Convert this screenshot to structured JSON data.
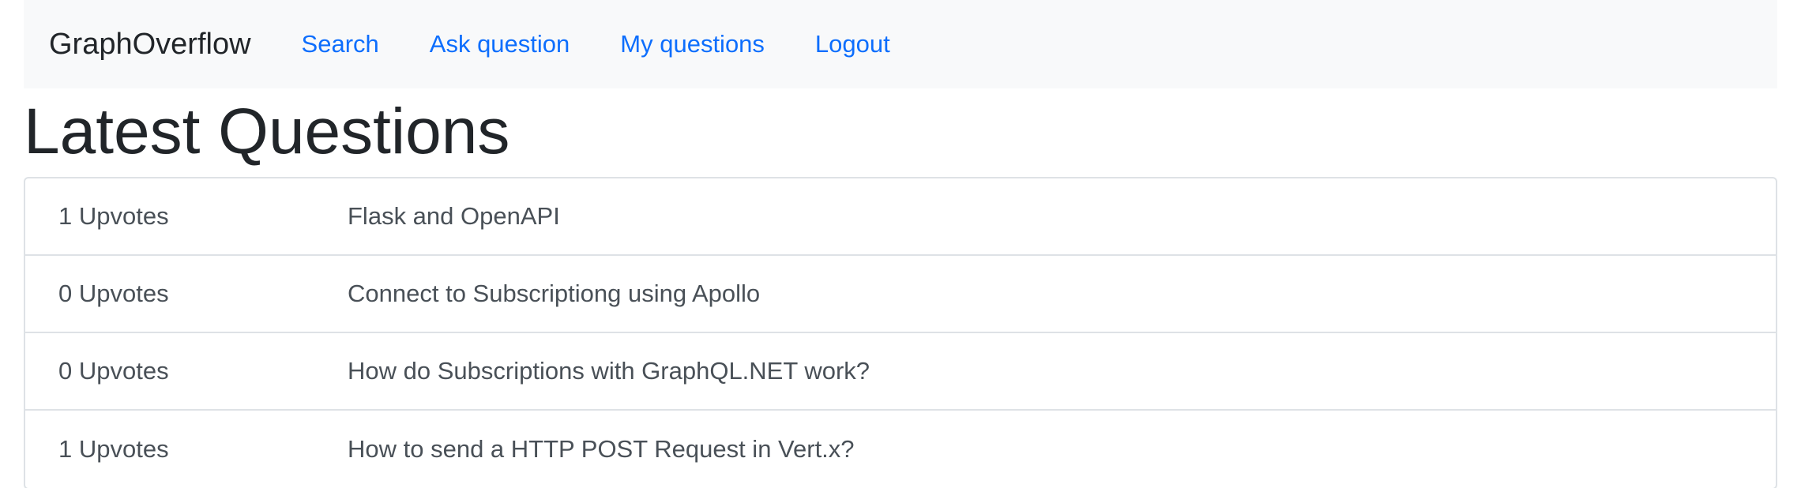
{
  "navbar": {
    "brand": "GraphOverflow",
    "links": [
      {
        "label": "Search"
      },
      {
        "label": "Ask question"
      },
      {
        "label": "My questions"
      },
      {
        "label": "Logout"
      }
    ]
  },
  "page": {
    "title": "Latest Questions"
  },
  "questions": [
    {
      "votes": "1 Upvotes",
      "title": "Flask and OpenAPI"
    },
    {
      "votes": "0 Upvotes",
      "title": "Connect to Subscriptiong using Apollo"
    },
    {
      "votes": "0 Upvotes",
      "title": "How do Subscriptions with GraphQL.NET work?"
    },
    {
      "votes": "1 Upvotes",
      "title": "How to send a HTTP POST Request in Vert.x?"
    }
  ],
  "colors": {
    "link": "#0d6efd",
    "navbar_bg": "#f8f9fa",
    "text": "#212529",
    "muted_text": "#495057",
    "border": "#dee2e6"
  }
}
